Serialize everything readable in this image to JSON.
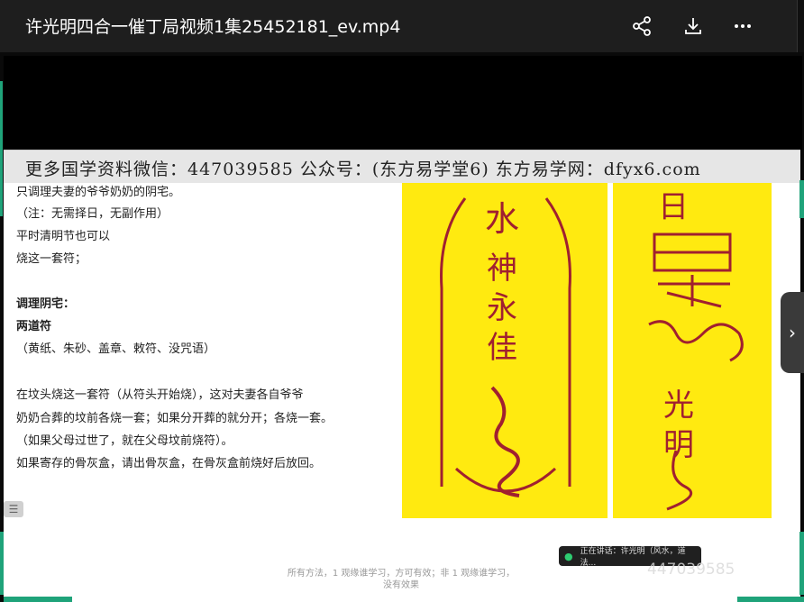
{
  "window": {
    "title": "许光明四合一催丁局视频1集25452181_ev.mp4",
    "icons": [
      "share-icon",
      "download-icon",
      "more-icon"
    ]
  },
  "banner": {
    "text": "更多国学资料微信：447039585 公众号：(东方易学堂6) 东方易学网：dfyx6.com"
  },
  "slide": {
    "lines": [
      "只调理夫妻的爷爷奶奶的阴宅。",
      "（注：无需择日，无副作用）",
      "平时清明节也可以",
      "烧这一套符；",
      "调理阴宅：",
      "两道符",
      "（黄纸、朱砂、盖章、敕符、没咒语）",
      "在坟头烧这一套符（从符头开始烧），这对夫妻各自爷爷",
      "奶奶合葬的坟前各烧一套；如果分开葬的就分开；各烧一套。",
      "（如果父母过世了，就在父母坟前烧符）。",
      "如果寄存的骨灰盒，请出骨灰盒，在骨灰盒前烧好后放回。"
    ],
    "talisman_left": [
      "水",
      "神",
      "永",
      "佳"
    ],
    "talisman_right": [
      "日",
      "光",
      "明"
    ],
    "footer_1": "所有方法，1 观缘谁学习，方可有效；非 1 观缘谁学习，",
    "footer_2": "没有效果"
  },
  "overlay": {
    "speaker": "正在讲话：许光明（风水，道法...",
    "watermark": "447039585"
  },
  "colors": {
    "titlebar": "#1e1e1e",
    "talisman_paper": "#ffea10",
    "talisman_ink": "#a02030",
    "accent_green": "#1fa37a"
  }
}
